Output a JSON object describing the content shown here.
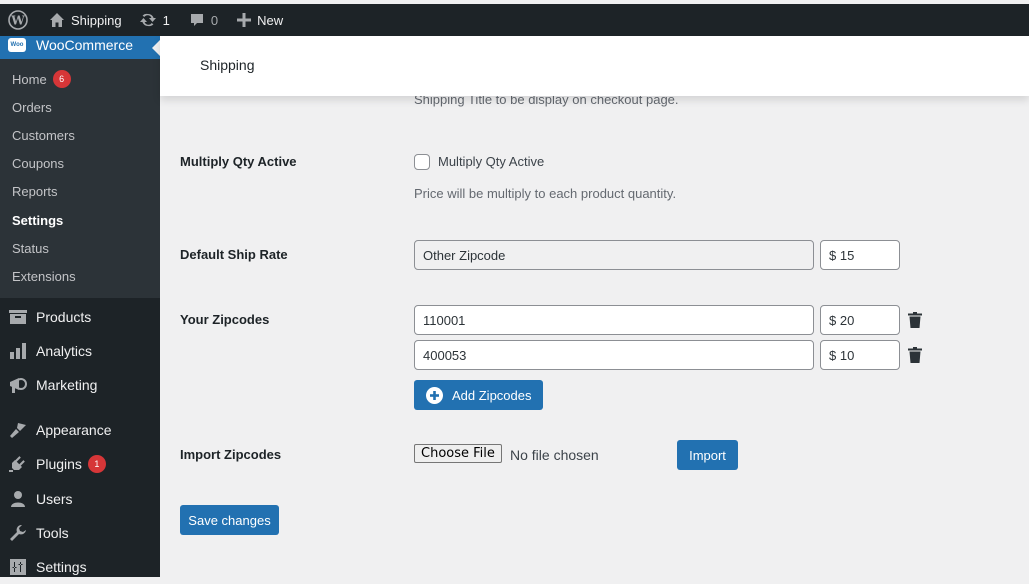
{
  "adminbar": {
    "site_name": "Shipping",
    "updates_count": "1",
    "comments_count": "0",
    "new_label": "New"
  },
  "sidebar": {
    "current_menu": "WooCommerce",
    "woo_icon_text": "Woo",
    "submenu": [
      {
        "label": "Home",
        "badge": "6"
      },
      {
        "label": "Orders"
      },
      {
        "label": "Customers"
      },
      {
        "label": "Coupons"
      },
      {
        "label": "Reports"
      },
      {
        "label": "Settings",
        "current": true
      },
      {
        "label": "Status"
      },
      {
        "label": "Extensions"
      }
    ],
    "menu": [
      {
        "label": "Products",
        "icon": "archive-icon"
      },
      {
        "label": "Analytics",
        "icon": "bar-chart-icon"
      },
      {
        "label": "Marketing",
        "icon": "megaphone-icon"
      },
      {
        "label": "Appearance",
        "icon": "paintbrush-icon"
      },
      {
        "label": "Plugins",
        "icon": "plug-icon",
        "badge": "1"
      },
      {
        "label": "Users",
        "icon": "user-icon"
      },
      {
        "label": "Tools",
        "icon": "wrench-icon"
      },
      {
        "label": "Settings",
        "icon": "sliders-icon"
      }
    ]
  },
  "header": {
    "title": "Shipping"
  },
  "form": {
    "shipping_title_desc": "Shipping Title to be display on checkout page.",
    "multiply": {
      "label": "Multiply Qty Active",
      "checkbox_label": "Multiply Qty Active",
      "checked": false,
      "desc": "Price will be multiply to each product quantity."
    },
    "default_rate": {
      "label": "Default Ship Rate",
      "zipcode": "Other Zipcode",
      "price": "$ 15"
    },
    "zipcodes": {
      "label": "Your Zipcodes",
      "rows": [
        {
          "zipcode": "110001",
          "price": "$ 20"
        },
        {
          "zipcode": "400053",
          "price": "$ 10"
        }
      ],
      "add_button": "Add Zipcodes"
    },
    "import": {
      "label": "Import Zipcodes",
      "choose_button": "Choose File",
      "file_status": "No file chosen",
      "import_button": "Import"
    },
    "save_button": "Save changes"
  },
  "colors": {
    "accent": "#2271b1",
    "adminbar_bg": "#1d2327",
    "badge": "#d63638",
    "content_bg": "#f0f0f1"
  }
}
